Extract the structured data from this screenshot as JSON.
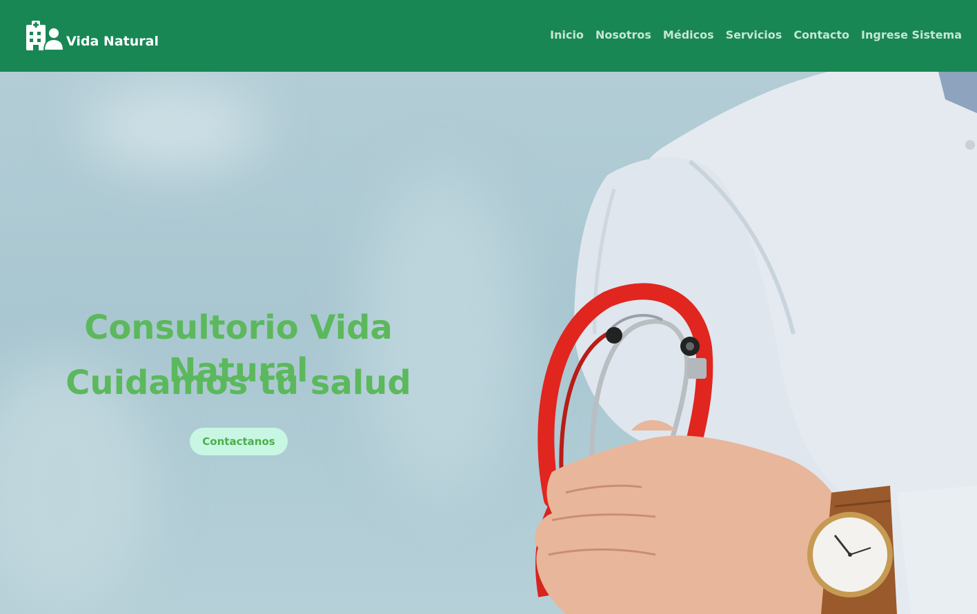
{
  "brand": {
    "name": "Vida Natural",
    "icon": "hospital-user-icon"
  },
  "nav": {
    "items": [
      {
        "label": "Inicio"
      },
      {
        "label": "Nosotros"
      },
      {
        "label": "Médicos"
      },
      {
        "label": "Servicios"
      },
      {
        "label": "Contacto"
      },
      {
        "label": "Ingrese Sistema"
      }
    ]
  },
  "hero": {
    "title": "Consultorio Vida Natural",
    "subtitle": "Cuidamos tú salud",
    "cta_label": "Contactanos"
  },
  "colors": {
    "navbar": "#198754",
    "nav_text": "#c8e6d5",
    "hero_text": "#5cb85c",
    "cta_bg": "#c7f7e2"
  }
}
